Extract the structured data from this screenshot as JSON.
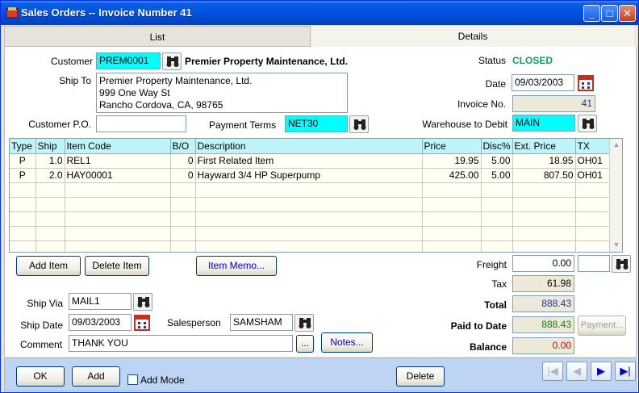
{
  "window": {
    "title": "Sales Orders -- Invoice Number 41",
    "minimize": "_",
    "maximize": "□",
    "close": "✕"
  },
  "tabs": {
    "list": "List",
    "details": "Details"
  },
  "customer": {
    "label": "Customer",
    "code": "PREM0001",
    "name": "Premier Property Maintenance, Ltd."
  },
  "ship_to": {
    "label": "Ship To",
    "line1": "Premier Property Maintenance, Ltd.",
    "line2": "999 One Way St",
    "line3": "Rancho Cordova, CA, 98765"
  },
  "customer_po": {
    "label": "Customer P.O.",
    "value": ""
  },
  "payment_terms": {
    "label": "Payment Terms",
    "value": "NET30"
  },
  "status": {
    "label": "Status",
    "value": "CLOSED",
    "color": "#10a060"
  },
  "date": {
    "label": "Date",
    "value": "09/03/2003"
  },
  "invoice_no": {
    "label": "Invoice No.",
    "value": "41"
  },
  "warehouse": {
    "label": "Warehouse to Debit",
    "value": "MAIN"
  },
  "grid": {
    "headers": [
      "Type",
      "Ship",
      "Item Code",
      "B/O",
      "Description",
      "Price",
      "Disc%",
      "Ext. Price",
      "TX"
    ],
    "rows": [
      [
        "P",
        "1.0",
        "REL1",
        "0",
        "First Related Item",
        "19.95",
        "5.00",
        "18.95",
        "OH01"
      ],
      [
        "P",
        "2.0",
        "HAY00001",
        "0",
        "Hayward 3/4 HP Superpump",
        "425.00",
        "5.00",
        "807.50",
        "OH01"
      ]
    ]
  },
  "buttons": {
    "add_item": "Add Item",
    "delete_item": "Delete Item",
    "item_memo": "Item Memo...",
    "notes": "Notes...",
    "payment": "Payment...",
    "ok": "OK",
    "add": "Add",
    "delete": "Delete",
    "ellipsis": "..."
  },
  "add_mode": {
    "label": "Add Mode",
    "checked": false
  },
  "ship_via": {
    "label": "Ship Via",
    "value": "MAIL1"
  },
  "ship_date": {
    "label": "Ship Date",
    "value": "09/03/2003"
  },
  "salesperson": {
    "label": "Salesperson",
    "value": "SAMSHAM"
  },
  "comment": {
    "label": "Comment",
    "value": "THANK YOU"
  },
  "totals": {
    "freight_label": "Freight",
    "freight": "0.00",
    "freight_code": "",
    "tax_label": "Tax",
    "tax": "61.98",
    "total_label": "Total",
    "total": "888.43",
    "paid_label": "Paid to Date",
    "paid": "888.43",
    "balance_label": "Balance",
    "balance": "0.00"
  },
  "colors": {
    "total": "#2030c0",
    "paid": "#108010",
    "balance": "#c01010",
    "invoice_no": "#2030c0"
  },
  "nav": {
    "first": "|◀",
    "prev": "◀",
    "next": "▶",
    "last": "▶|"
  }
}
